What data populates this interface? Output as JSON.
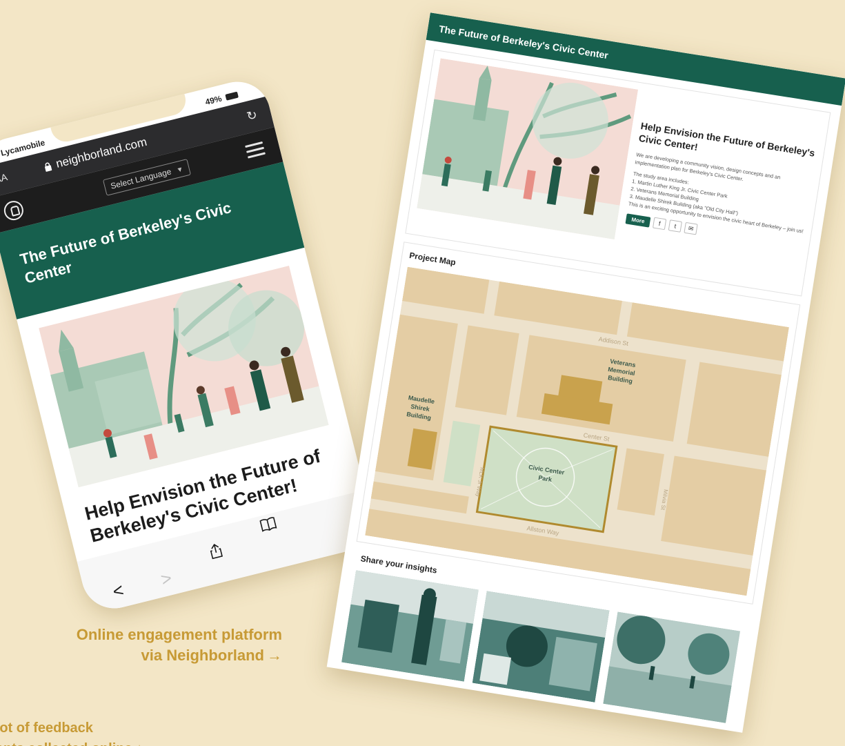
{
  "phone": {
    "carrier": "Lycamobile",
    "battery": "49%",
    "text_size_button": "AA",
    "url": "neighborland.com",
    "language_select": "Select Language",
    "hero_title": "The Future of Berkeley's Civic Center",
    "headline": "Help Envision the Future of Berkeley's Civic Center!"
  },
  "desktop": {
    "header_title": "The Future of Berkeley's Civic Center",
    "card": {
      "title": "Help Envision the Future of Berkeley's Civic Center!",
      "description": "We are developing a community vision, design concepts and an implementation plan for Berkeley's Civic Center.",
      "list_intro": "The study area includes:",
      "items": [
        "1. Martin Luther King Jr. Civic Center Park",
        "2. Veterans Memorial Building",
        "3. Maudelle Shirek Building (aka \"Old City Hall\")"
      ],
      "closing": "This is an exciting opportunity to envision the civic heart of Berkeley – join us!",
      "more_button": "More",
      "share_facebook": "f",
      "share_twitter": "t",
      "share_email": "✉"
    },
    "map": {
      "title": "Project Map",
      "street_addison": "Addison St",
      "street_center": "Center St",
      "street_allston": "Allston Way",
      "street_mlk": "MLK Jr Way",
      "street_milvia": "Milvia St",
      "label_veterans_1": "Veterans",
      "label_veterans_2": "Memorial",
      "label_veterans_3": "Building",
      "label_maudelle_1": "Maudelle",
      "label_maudelle_2": "Shirek",
      "label_maudelle_3": "Building",
      "label_park_1": "Civic Center",
      "label_park_2": "Park"
    },
    "share_title": "Share your insights"
  },
  "captions": {
    "main_line1": "Online engagement platform",
    "main_line2": "via Neighborland",
    "main_arrow": "→",
    "cut_line1": "shot of feedback",
    "cut_line2": "ments collected online ↓"
  },
  "colors": {
    "background": "#f3e6c6",
    "brand_green": "#17604e",
    "caption_gold": "#c79a35",
    "map_block": "#e4cda4",
    "map_building": "#c9a24d",
    "map_park": "#cfe0c6"
  }
}
